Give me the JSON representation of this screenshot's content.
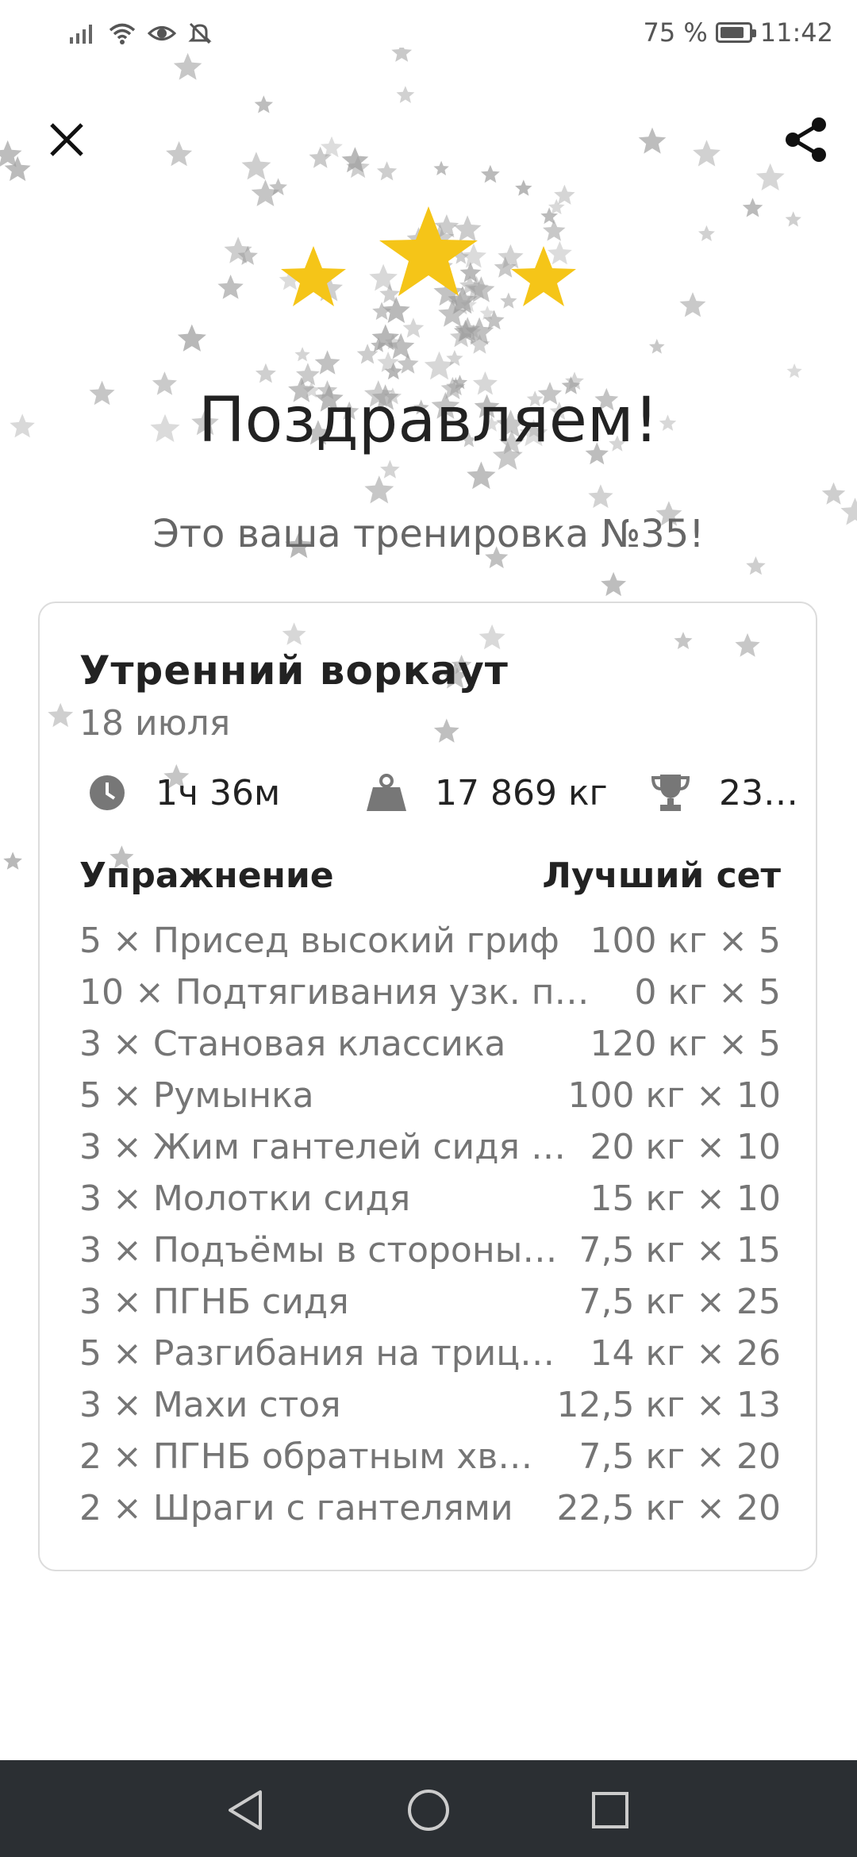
{
  "status_bar": {
    "battery_text": "75 %",
    "time": "11:42",
    "battery_level": 0.75,
    "icons": [
      "signal-icon",
      "wifi-icon",
      "eye-icon",
      "bell-off-icon",
      "battery-icon"
    ]
  },
  "header": {
    "close_icon": "close-icon",
    "share_icon": "share-icon"
  },
  "celebration": {
    "rating_stars": 3,
    "star_color": "#F5C518",
    "title": "Поздравляем!",
    "subtitle": "Это ваша тренировка №35!"
  },
  "workout": {
    "name": "Утренний воркаут",
    "date": "18 июля",
    "stats": {
      "duration": "1ч 36м",
      "volume": "17 869 кг",
      "records": "23…"
    },
    "columns": {
      "exercise": "Упражнение",
      "best_set": "Лучший сет"
    },
    "exercises": [
      {
        "name": "5 × Присед высокий гриф",
        "best": "100 кг × 5"
      },
      {
        "name": "10 × Подтягивания узк. п…",
        "best": "0 кг × 5"
      },
      {
        "name": "3 × Становая классика",
        "best": "120 кг × 5"
      },
      {
        "name": "5 × Румынка",
        "best": "100 кг × 10"
      },
      {
        "name": "3 × Жим гантелей сидя …",
        "best": "20 кг × 10"
      },
      {
        "name": "3 × Молотки сидя",
        "best": "15 кг × 10"
      },
      {
        "name": "3 × Подъёмы в стороны…",
        "best": "7,5 кг × 15"
      },
      {
        "name": "3 × ПГНБ сидя",
        "best": "7,5 кг × 25"
      },
      {
        "name": "5 × Разгибания на триц…",
        "best": "14 кг × 26"
      },
      {
        "name": "3 × Махи стоя",
        "best": "12,5 кг × 13"
      },
      {
        "name": "2 × ПГНБ обратным хв…",
        "best": "7,5 кг × 20"
      },
      {
        "name": "2 × Шраги с гантелями",
        "best": "22,5 кг × 20"
      }
    ]
  },
  "nav": {
    "icons": [
      "back-icon",
      "home-icon",
      "recents-icon"
    ]
  }
}
